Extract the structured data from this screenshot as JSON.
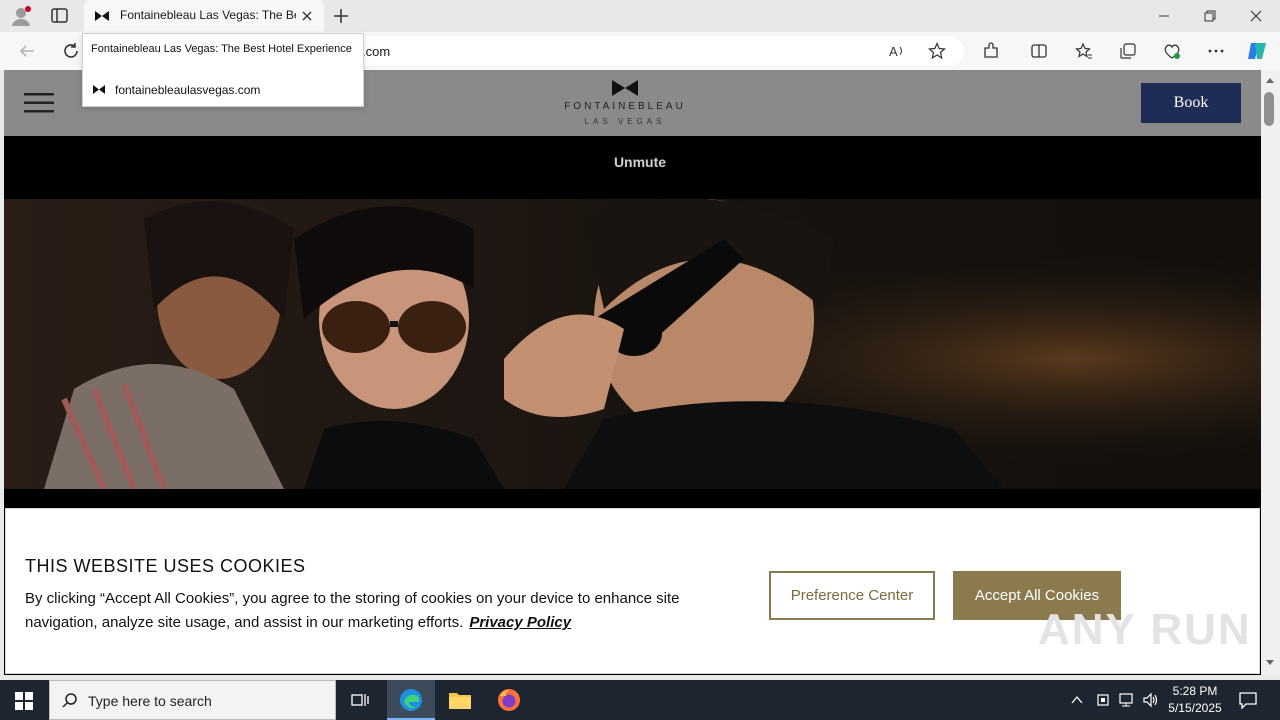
{
  "browser": {
    "tab_title": "Fontainebleau Las Vegas: The Best Hotel Experience",
    "url": "fontainebleaulasvegas.com",
    "url_partial": ".com"
  },
  "tooltip": {
    "title": "Fontainebleau Las Vegas: The Best Hotel Experience",
    "domain": "fontainebleaulasvegas.com"
  },
  "site": {
    "logo_text": "FONTAINEBLEAU",
    "logo_sub": "LAS VEGAS",
    "book_label": "Book",
    "unmute_label": "Unmute"
  },
  "cookie": {
    "title": "THIS WEBSITE USES COOKIES",
    "body": "By clicking “Accept All Cookies”, you agree to the storing of cookies on your device to enhance site navigation, analyze site usage, and assist in our marketing efforts.",
    "privacy_link": "Privacy Policy",
    "preference_label": "Preference Center",
    "accept_label": "Accept All Cookies"
  },
  "watermark": "ANY RUN",
  "taskbar": {
    "search_placeholder": "Type here to search",
    "time": "5:28 PM",
    "date": "5/15/2025"
  },
  "colors": {
    "book_button": "#1f2c56",
    "cookie_accent": "#8a7a4e",
    "taskbar": "#1c2530"
  }
}
